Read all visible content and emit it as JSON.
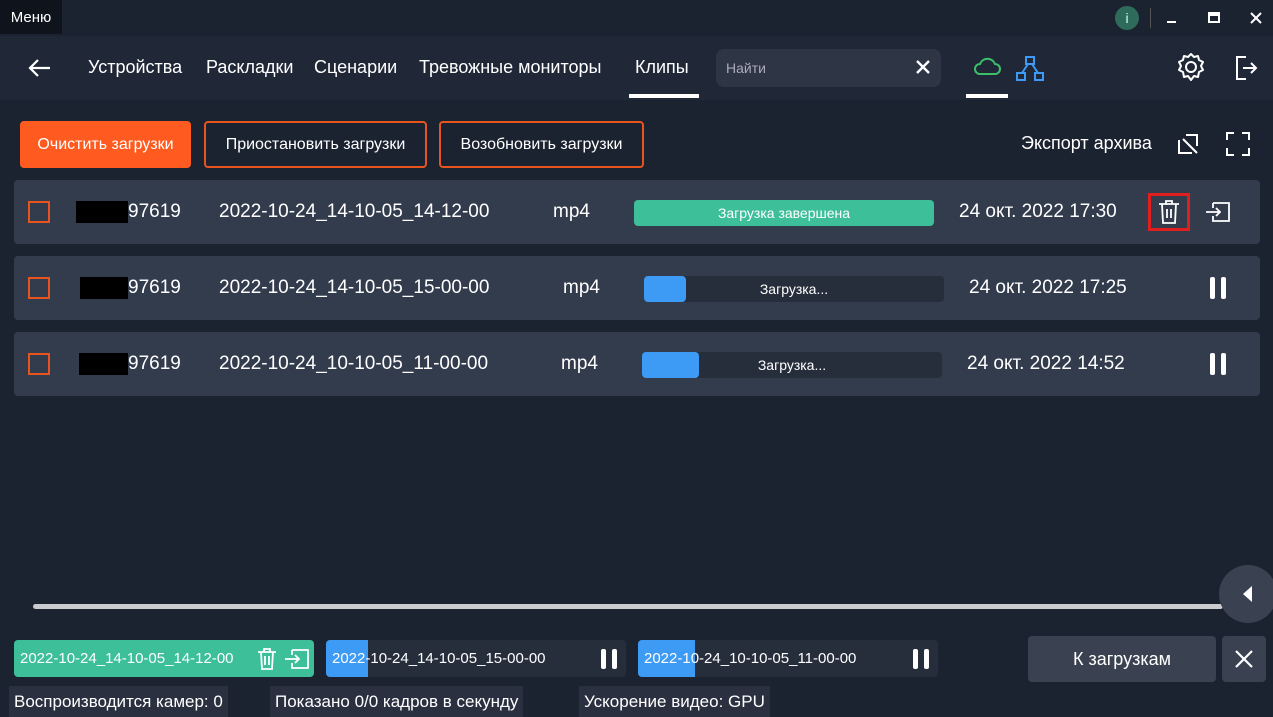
{
  "titlebar": {
    "menu_label": "Меню",
    "info_label": "i"
  },
  "nav": {
    "items": [
      "Устройства",
      "Раскладки",
      "Сценарии",
      "Тревожные мониторы",
      "Клипы"
    ],
    "search_placeholder": "Найти"
  },
  "toolbar": {
    "clear": "Очистить загрузки",
    "pause": "Приостановить загрузки",
    "resume": "Возобновить загрузки",
    "export": "Экспорт архива"
  },
  "rows": [
    {
      "camera_suffix": "97619",
      "clip": "2022-10-24_14-10-05_14-12-00",
      "format": "mp4",
      "status": "Загрузка завершена",
      "progress": 1.0,
      "date": "24 окт. 2022 17:30"
    },
    {
      "camera_suffix": "97619",
      "clip": "2022-10-24_14-10-05_15-00-00",
      "format": "mp4",
      "status": "Загрузка...",
      "progress": 0.14,
      "date": "24 окт. 2022 17:25"
    },
    {
      "camera_suffix": "97619",
      "clip": "2022-10-24_10-10-05_11-00-00",
      "format": "mp4",
      "status": "Загрузка...",
      "progress": 0.19,
      "date": "24 окт. 2022 14:52"
    }
  ],
  "chips": [
    {
      "clip": "2022-10-24_14-10-05_14-12-00"
    },
    {
      "clip": "2022-10-24_14-10-05_15-00-00"
    },
    {
      "clip": "2022-10-24_10-10-05_11-00-00"
    }
  ],
  "footer": {
    "to_downloads": "К загрузкам"
  },
  "status": {
    "cameras": "Воспроизводится камер: 0",
    "fps": "Показано 0/0 кадров в секунду",
    "accel": "Ускорение видео: GPU"
  },
  "colors": {
    "accent": "#ff5a1f",
    "done": "#3dbf9a",
    "progress": "#3d9bf5"
  }
}
